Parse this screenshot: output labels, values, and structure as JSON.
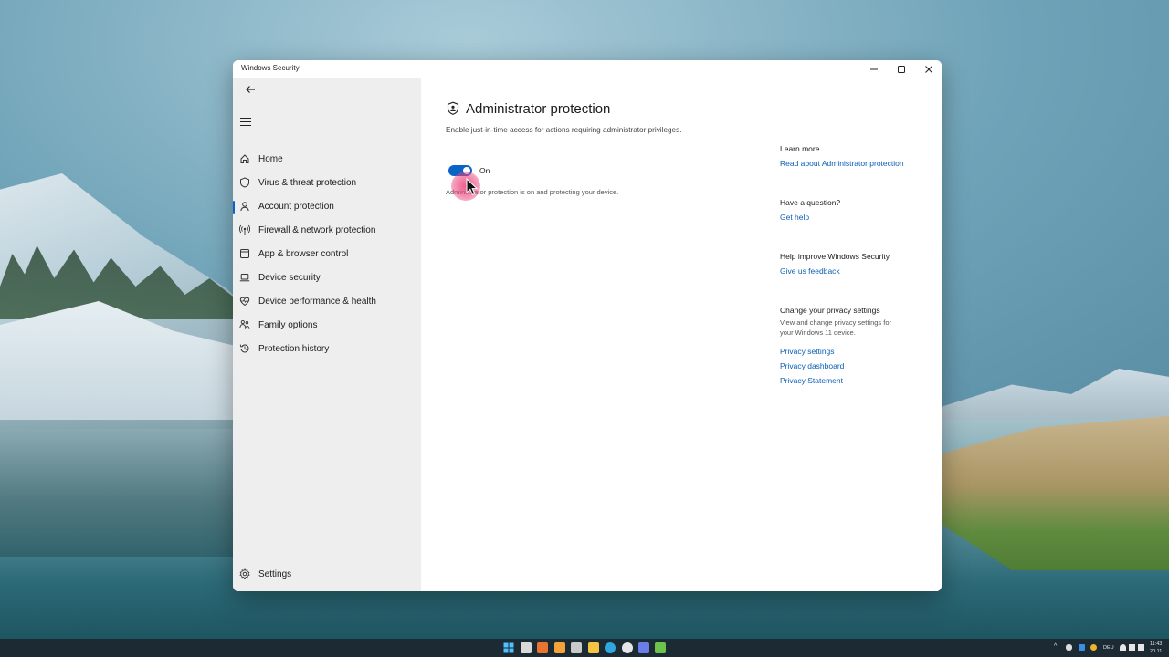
{
  "window": {
    "title": "Windows Security"
  },
  "sidebar": {
    "items": [
      {
        "label": "Home",
        "icon": "home-icon"
      },
      {
        "label": "Virus & threat protection",
        "icon": "shield-icon"
      },
      {
        "label": "Account protection",
        "icon": "person-icon"
      },
      {
        "label": "Firewall & network protection",
        "icon": "antenna-icon"
      },
      {
        "label": "App & browser control",
        "icon": "browser-window-icon"
      },
      {
        "label": "Device security",
        "icon": "laptop-icon"
      },
      {
        "label": "Device performance & health",
        "icon": "heart-pulse-icon"
      },
      {
        "label": "Family options",
        "icon": "family-icon"
      },
      {
        "label": "Protection history",
        "icon": "history-icon"
      }
    ],
    "active_item": "Account protection",
    "settings_label": "Settings"
  },
  "main": {
    "title": "Administrator protection",
    "subtitle": "Enable just-in-time access for actions requiring administrator privileges.",
    "toggle": {
      "state": "on",
      "label": "On"
    },
    "status": "Administrator protection is on and protecting your device."
  },
  "right_panel": {
    "learn_more": {
      "heading": "Learn more",
      "link": "Read about Administrator protection"
    },
    "question": {
      "heading": "Have a question?",
      "link": "Get help"
    },
    "feedback": {
      "heading": "Help improve Windows Security",
      "link": "Give us feedback"
    },
    "privacy": {
      "heading": "Change your privacy settings",
      "description": "View and change privacy settings for your Windows 11 device.",
      "links": [
        "Privacy settings",
        "Privacy dashboard",
        "Privacy Statement"
      ]
    }
  },
  "taskbar": {
    "language": "DEU",
    "time": "11:43",
    "date": "20.11."
  },
  "colors": {
    "accent": "#0a64c8",
    "link": "#0a5fb4",
    "sidebar_bg": "#eeeeee",
    "click_indicator": "#ec407a"
  }
}
